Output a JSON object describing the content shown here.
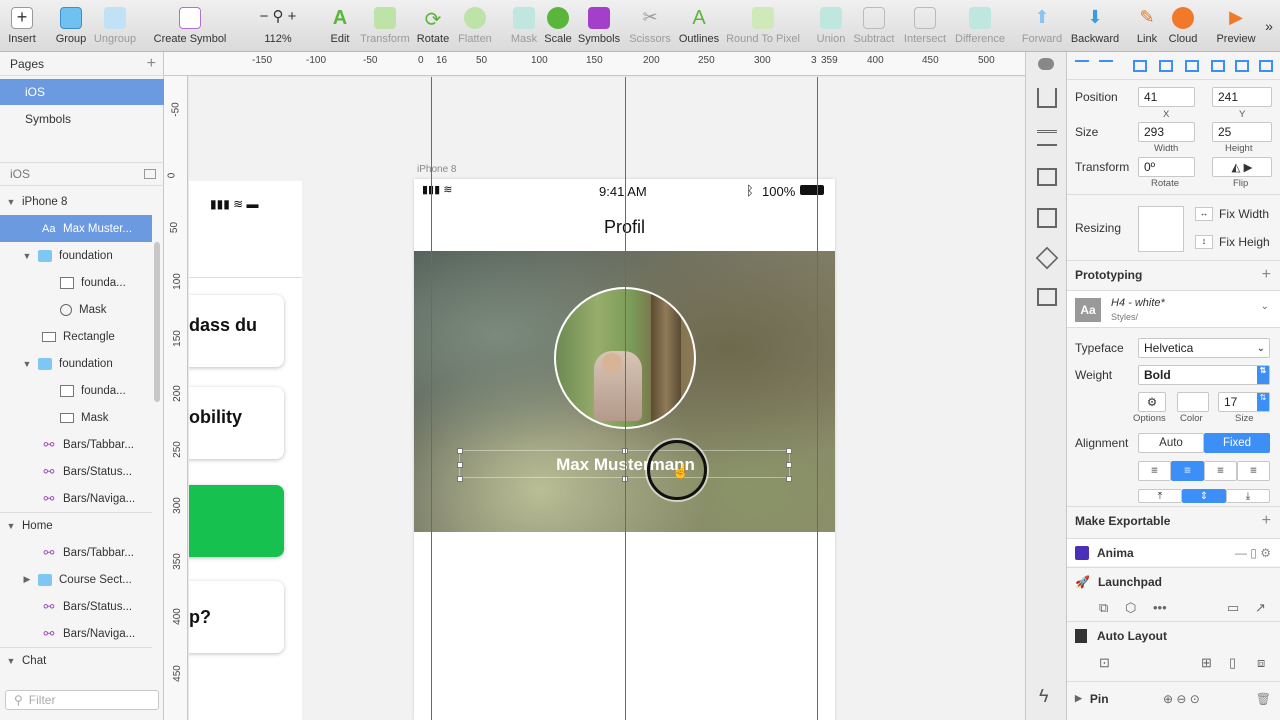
{
  "toolbar": {
    "insert": "Insert",
    "group": "Group",
    "ungroup": "Ungroup",
    "create_symbol": "Create Symbol",
    "zoom": "112%",
    "edit": "Edit",
    "transform": "Transform",
    "rotate": "Rotate",
    "flatten": "Flatten",
    "mask": "Mask",
    "scale": "Scale",
    "symbols": "Symbols",
    "scissors": "Scissors",
    "outlines": "Outlines",
    "round": "Round To Pixel",
    "union": "Union",
    "subtract": "Subtract",
    "intersect": "Intersect",
    "difference": "Difference",
    "forward": "Forward",
    "backward": "Backward",
    "link": "Link",
    "cloud": "Cloud",
    "preview": "Preview"
  },
  "pages": {
    "header": "Pages",
    "items": [
      "iOS",
      "Symbols"
    ]
  },
  "layers": {
    "page_title": "iOS",
    "items": [
      "iPhone 8",
      "Max Muster...",
      "foundation",
      "founda...",
      "Mask",
      "Rectangle",
      "foundation",
      "founda...",
      "Mask",
      "Bars/Tabbar...",
      "Bars/Status...",
      "Bars/Naviga...",
      "Home",
      "Bars/Tabbar...",
      "Course Sect...",
      "Bars/Status...",
      "Bars/Naviga...",
      "Chat"
    ],
    "filter_placeholder": "Filter"
  },
  "rulers": {
    "top": [
      "-150",
      "-100",
      "-50",
      "0",
      "16",
      "50",
      "100",
      "150",
      "200",
      "250",
      "300",
      "3",
      "359",
      "400",
      "450",
      "500"
    ],
    "left": [
      "-50",
      "0",
      "50",
      "100",
      "150",
      "200",
      "250",
      "300",
      "350",
      "400",
      "450"
    ]
  },
  "canvas": {
    "artboard_label": "iPhone 8",
    "left_cards": [
      "dass du",
      "obility",
      "",
      "p?"
    ],
    "status_time": "9:41 AM",
    "status_battery": "100%",
    "nav_title": "Profil",
    "profile_name": "Max Mustermann"
  },
  "inspector": {
    "position_label": "Position",
    "x": "41",
    "y": "241",
    "x_label": "X",
    "y_label": "Y",
    "size_label": "Size",
    "width": "293",
    "height": "25",
    "width_label": "Width",
    "height_label": "Height",
    "transform_label": "Transform",
    "rotate": "0º",
    "rotate_label": "Rotate",
    "flip_label": "Flip",
    "resizing_label": "Resizing",
    "fix_width": "Fix Width",
    "fix_height": "Fix Heigh",
    "prototyping": "Prototyping",
    "style_name": "H4 - white*",
    "style_path": "Styles/",
    "typeface_label": "Typeface",
    "typeface": "Helvetica",
    "weight_label": "Weight",
    "weight": "Bold",
    "options_label": "Options",
    "color_label": "Color",
    "size_value": "17",
    "size_lbl": "Size",
    "alignment_label": "Alignment",
    "align_auto": "Auto",
    "align_fixed": "Fixed",
    "make_exportable": "Make Exportable",
    "anima": "Anima",
    "launchpad": "Launchpad",
    "auto_layout": "Auto Layout",
    "pin": "Pin"
  },
  "colors": {
    "accent": "#3b8ff7",
    "selection": "#6b9ae0",
    "guide": "#c02ad0"
  }
}
